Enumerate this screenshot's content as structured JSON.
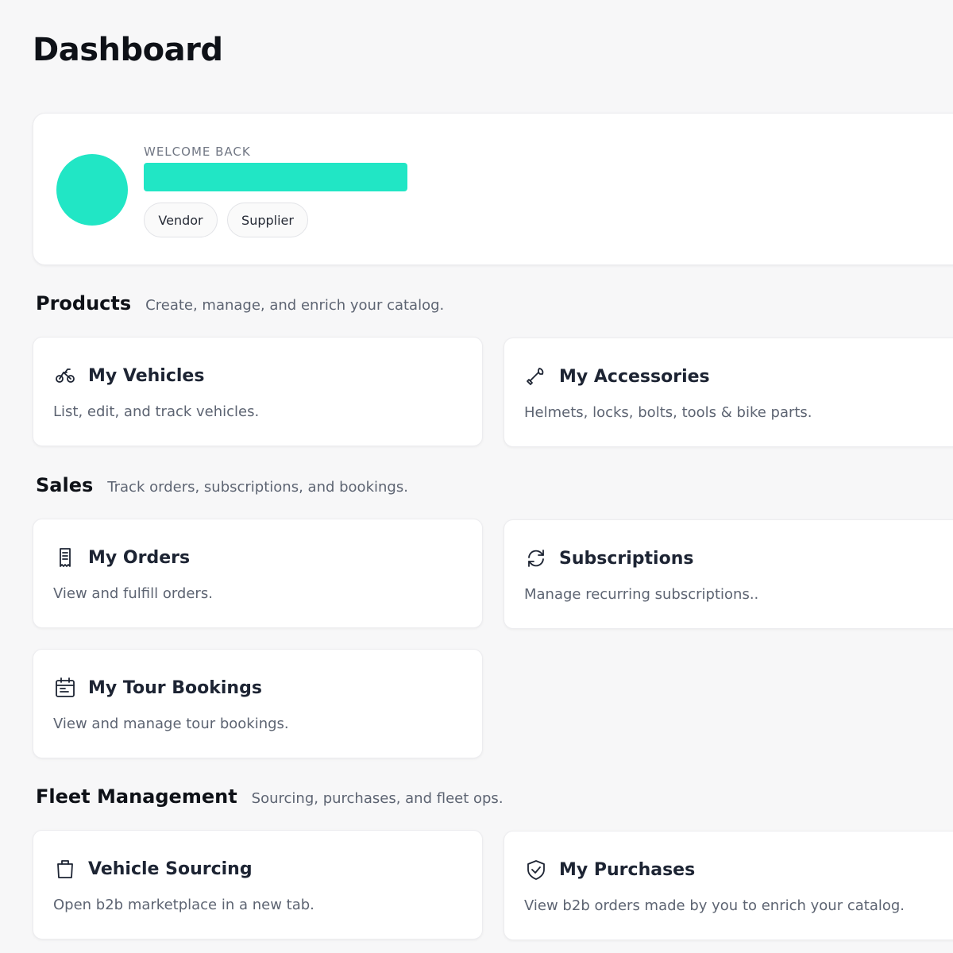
{
  "page": {
    "title": "Dashboard"
  },
  "welcome": {
    "label": "WELCOME BACK",
    "accent_color": "#21e6c5",
    "roles": [
      "Vendor",
      "Supplier"
    ]
  },
  "sections": {
    "products": {
      "title": "Products",
      "description": "Create, manage, and enrich your catalog.",
      "cards": [
        {
          "title": "My Vehicles",
          "description": "List, edit, and track vehicles.",
          "icon": "bike-icon"
        },
        {
          "title": "My Accessories",
          "description": "Helmets, locks, bolts, tools & bike parts.",
          "icon": "wrench-icon"
        }
      ]
    },
    "sales": {
      "title": "Sales",
      "description": "Track orders, subscriptions, and bookings.",
      "cards": [
        {
          "title": "My Orders",
          "description": "View and fulfill orders.",
          "icon": "receipt-icon"
        },
        {
          "title": "Subscriptions",
          "description": "Manage recurring subscriptions..",
          "icon": "refresh-icon"
        },
        {
          "title": "My Tour Bookings",
          "description": "View and manage tour bookings.",
          "icon": "calendar-icon"
        }
      ]
    },
    "fleet": {
      "title": "Fleet Management",
      "description": "Sourcing, purchases, and fleet ops.",
      "cards": [
        {
          "title": "Vehicle Sourcing",
          "description": "Open b2b marketplace in a new tab.",
          "icon": "shopping-bag-icon"
        },
        {
          "title": "My Purchases",
          "description": "View b2b orders made by you to enrich your catalog.",
          "icon": "shield-check-icon"
        }
      ]
    }
  }
}
